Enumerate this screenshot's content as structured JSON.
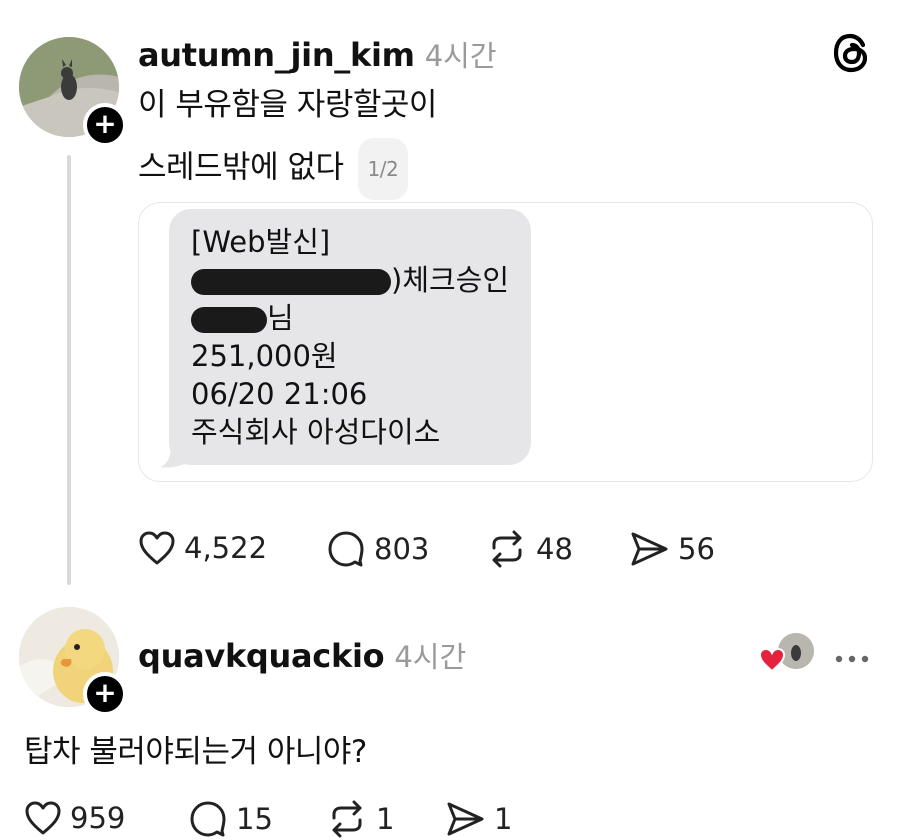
{
  "post": {
    "username": "autumn_jin_kim",
    "time": "4시간",
    "line1": "이 부유함을 자랑할곳이",
    "line2": "스레드밖에 없다",
    "page_indicator": "1/2",
    "sms": {
      "line1": "[Web발신]",
      "line2_suffix": ")체크승인",
      "line3_suffix": "님",
      "amount": "251,000원",
      "datetime": "06/20 21:06",
      "merchant": "주식회사 아성다이소"
    },
    "likes": "4,522",
    "comments": "803",
    "reposts": "48",
    "shares": "56"
  },
  "reply": {
    "username": "quavkquackio",
    "time": "4시간",
    "text": "탑차 불러야되는거 아니야?",
    "likes": "959",
    "comments": "15",
    "reposts": "1",
    "shares": "1"
  },
  "icons": {
    "app_logo": "threads-logo-icon",
    "like": "heart-icon",
    "comment": "comment-bubble-icon",
    "repost": "repost-icon",
    "share": "send-icon",
    "more": "more-dots-icon"
  },
  "colors": {
    "accent_heart": "#e5223e",
    "muted": "#9a9a9a"
  }
}
